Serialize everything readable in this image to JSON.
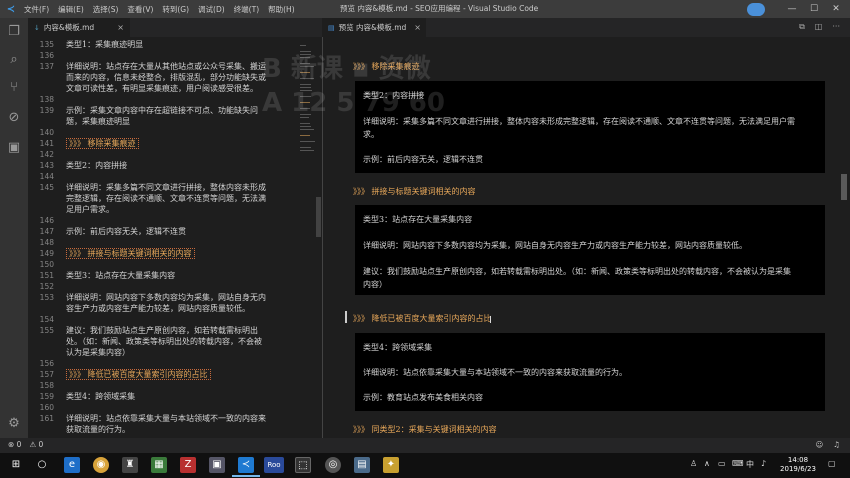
{
  "titlebar": {
    "menu": [
      "文件(F)",
      "编辑(E)",
      "选择(S)",
      "查看(V)",
      "转到(G)",
      "调试(D)",
      "终端(T)",
      "帮助(H)"
    ],
    "title": "预览 内容&模板.md - SEO应用编程 - Visual Studio Code",
    "minimize": "—",
    "maximize": "☐",
    "close": "✕"
  },
  "left_tab": {
    "label": "内容&模板.md",
    "close": "×",
    "icon": "markdown-icon"
  },
  "right_tab": {
    "label": "预览 内容&模板.md",
    "close": "×",
    "icon": "preview-icon"
  },
  "editor": {
    "lines": [
      {
        "n": "135",
        "text": "类型1：采集痕迹明显",
        "h3": false
      },
      {
        "n": "136",
        "text": "",
        "h3": false
      },
      {
        "n": "137",
        "text": "详细说明：站点存在大量从其他站点或公众号采集、搬运",
        "h3": false
      },
      {
        "n": "",
        "text": "而来的内容，信息未经整合，排版混乱，部分功能缺失或",
        "h3": false
      },
      {
        "n": "",
        "text": "文章可读性差，有明显采集痕迹，用户阅读感受很差。",
        "h3": false
      },
      {
        "n": "138",
        "text": "",
        "h3": false
      },
      {
        "n": "139",
        "text": "示例：采集文章内容中存在超链接不可点、功能缺失问",
        "h3": false
      },
      {
        "n": "",
        "text": "题，采集痕迹明显",
        "h3": false
      },
      {
        "n": "140",
        "text": "",
        "h3": false
      },
      {
        "n": "141",
        "text": "》》》 移除采集痕迹",
        "h3": true
      },
      {
        "n": "142",
        "text": "",
        "h3": false
      },
      {
        "n": "143",
        "text": "类型2：内容拼接",
        "h3": false
      },
      {
        "n": "144",
        "text": "",
        "h3": false
      },
      {
        "n": "145",
        "text": "详细说明：采集多篇不同文章进行拼接，整体内容未形成",
        "h3": false
      },
      {
        "n": "",
        "text": "完整逻辑，存在阅读不通顺、文章不连贯等问题，无法满",
        "h3": false
      },
      {
        "n": "",
        "text": "足用户需求。",
        "h3": false
      },
      {
        "n": "146",
        "text": "",
        "h3": false
      },
      {
        "n": "147",
        "text": "示例：前后内容无关，逻辑不连贯",
        "h3": false
      },
      {
        "n": "148",
        "text": "",
        "h3": false
      },
      {
        "n": "149",
        "text": "》》》 拼接与标题关键词相关的内容",
        "h3": true
      },
      {
        "n": "150",
        "text": "",
        "h3": false
      },
      {
        "n": "151",
        "text": "类型3：站点存在大量采集内容",
        "h3": false
      },
      {
        "n": "152",
        "text": "",
        "h3": false
      },
      {
        "n": "153",
        "text": "详细说明：网站内容下多数内容均为采集，网站自身无内",
        "h3": false
      },
      {
        "n": "",
        "text": "容生产力或内容生产能力较差，网站内容质量较低。",
        "h3": false
      },
      {
        "n": "154",
        "text": "",
        "h3": false
      },
      {
        "n": "155",
        "text": "建议：我们鼓励站点生产原创内容，如若转载需标明出",
        "h3": false
      },
      {
        "n": "",
        "text": "处。（如：新闻、政策类等标明出处的转载内容，不会被",
        "h3": false
      },
      {
        "n": "",
        "text": "认为是采集内容）",
        "h3": false
      },
      {
        "n": "156",
        "text": "",
        "h3": false
      },
      {
        "n": "157",
        "text": "》》》 降低已被百度大量索引内容的占比",
        "h3": true
      },
      {
        "n": "158",
        "text": "",
        "h3": false
      },
      {
        "n": "159",
        "text": "类型4：跨领域采集",
        "h3": false
      },
      {
        "n": "160",
        "text": "",
        "h3": false
      },
      {
        "n": "161",
        "text": "详细说明：站点依靠采集大量与本站领域不一致的内容来",
        "h3": false
      },
      {
        "n": "",
        "text": "获取流量的行为。",
        "h3": false
      }
    ]
  },
  "preview": {
    "h3_1": "》》》 移除采集痕迹",
    "block1": [
      "类型2：内容拼接",
      "详细说明：采集多篇不同文章进行拼接，整体内容未形成完整逻辑，存在阅读不通顺、文章不连贯等问题，无法满足用户需",
      "求。",
      "示例：前后内容无关，逻辑不连贯"
    ],
    "h3_2": "》》》 拼接与标题关键词相关的内容",
    "block2": [
      "类型3：站点存在大量采集内容",
      "详细说明：网站内容下多数内容均为采集，网站自身无内容生产力或内容生产能力较差，网站内容质量较低。",
      "建议：我们鼓励站点生产原创内容，如若转载需标明出处。（如：新闻、政策类等标明出处的转载内容，不会被认为是采集",
      "内容）"
    ],
    "h3_3": "》》》 降低已被百度大量索引内容的占比",
    "block3": [
      "类型4：跨领域采集",
      "详细说明：站点依靠采集大量与本站领域不一致的内容来获取流量的行为。",
      "示例：教育站点发布美食相关内容"
    ],
    "h3_4": "》》》 同类型2：采集与关键词相关的内容"
  },
  "statusbar": {
    "errors": "⊗ 0",
    "warnings": "⚠ 0"
  },
  "taskbar": {
    "time": "14:08",
    "date": "2019/6/23",
    "ime": "中",
    "app_label_roo": "Roo"
  },
  "watermark": {
    "line1": "B 新课 ▪ 资微",
    "line2": "A 12 5 79   60"
  }
}
